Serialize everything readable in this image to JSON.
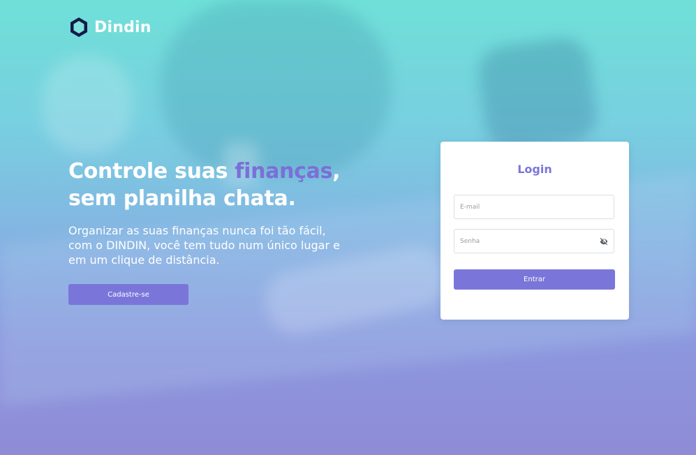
{
  "brand": {
    "name": "Dindin",
    "logo_icon": "hexagon-logo-icon"
  },
  "hero": {
    "title_line1_start": "Controle suas ",
    "title_line1_accent": "finanças",
    "title_line1_end": ",",
    "title_line2": "sem planilha chata.",
    "subtitle": "Organizar as suas finanças nunca foi tão fácil, com o DINDIN, você tem tudo num único lugar e em um clique de distância.",
    "signup_label": "Cadastre-se"
  },
  "login": {
    "title": "Login",
    "email_placeholder": "E-mail",
    "password_placeholder": "Senha",
    "password_toggle_icon": "eye-off-icon",
    "submit_label": "Entrar"
  },
  "colors": {
    "accent": "#7a76d9",
    "background_top": "#6fe0d8",
    "background_bottom": "#8f8bd6",
    "card": "#ffffff"
  }
}
